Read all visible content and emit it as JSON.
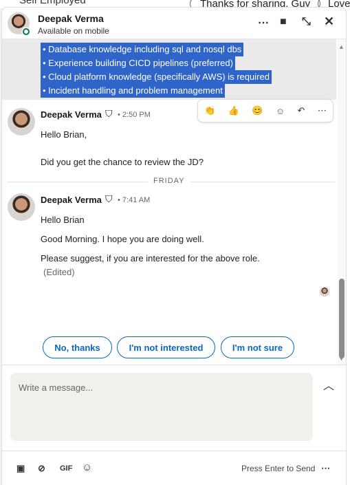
{
  "background": {
    "left_text": "Self Employed",
    "pill1": "Thanks for sharing, Guy",
    "pill2": "Love"
  },
  "header": {
    "name": "Deepak Verma",
    "status": "Available on mobile"
  },
  "selected_lines": [
    "• Database knowledge including sql and nosql dbs",
    "• Experience building CICD pipelines (preferred)",
    "• Cloud platform knowledge (specifically AWS) is required",
    "• Incident handling and problem management"
  ],
  "messages": [
    {
      "name": "Deepak Verma",
      "time": "• 2:50 PM",
      "lines": [
        "Hello Brian,",
        "Did you get the chance to review the JD?"
      ]
    },
    {
      "name": "Deepak Verma",
      "time": "• 7:41 AM",
      "lines": [
        "Hello Brian",
        "Good Morning. I hope you are doing well.",
        "Please suggest, if you are interested for the above role."
      ],
      "edited": "(Edited)"
    }
  ],
  "day_divider": "FRIDAY",
  "suggestions": [
    "No, thanks",
    "I'm not interested",
    "I'm not sure"
  ],
  "compose": {
    "placeholder": "Write a message..."
  },
  "footer": {
    "gif": "GIF",
    "send_hint": "Press Enter to Send"
  }
}
